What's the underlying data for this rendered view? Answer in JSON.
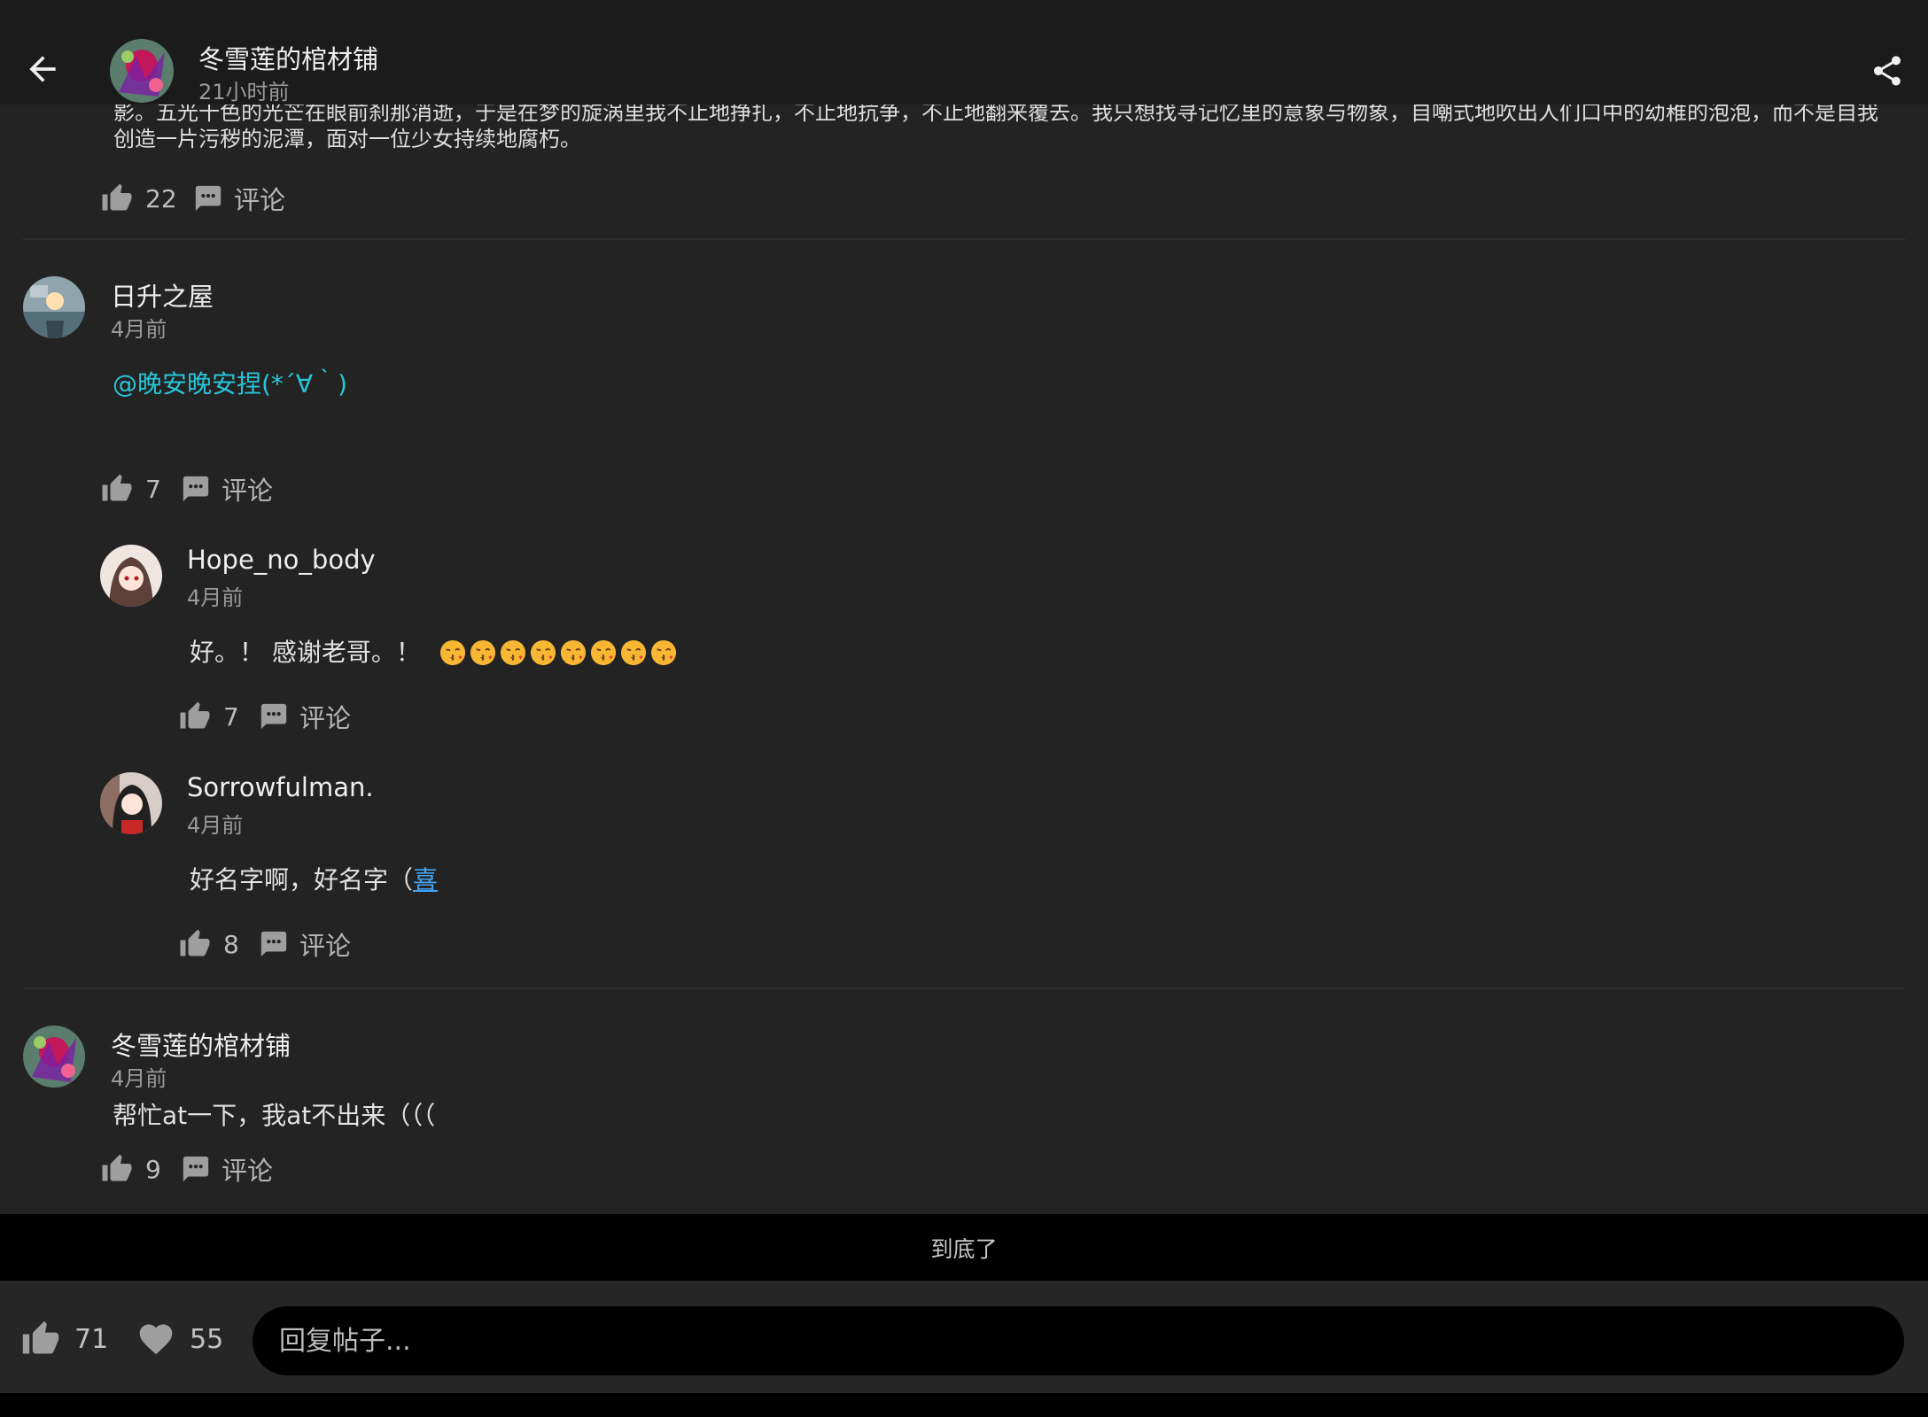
{
  "header": {
    "author": "冬雪莲的棺材铺",
    "time": "21小时前"
  },
  "post": {
    "text": "影。五光十色的光芒在眼前刹那消逝，于是在梦的旋涡里我不止地挣扎，不止地抗争，不止地翻来覆去。我只想找寻记忆里的意象与物象，自嘲式地吹出人们口中的幼稚的泡泡，而不是自我创造一片污秽的泥潭，面对一位少女持续地腐朽。",
    "likes": "22",
    "comment_label": "评论"
  },
  "comments": [
    {
      "user": "日升之屋",
      "time": "4月前",
      "text": "@晚安晚安捏(*´∀｀)",
      "likes": "7",
      "comment_label": "评论",
      "replies": [
        {
          "user": "Hope_no_body",
          "time": "4月前",
          "text": "好。！ 感谢老哥。！",
          "emoji_count": 8,
          "likes": "7",
          "comment_label": "评论"
        },
        {
          "user": "Sorrowfulman.",
          "time": "4月前",
          "text": "好名字啊，好名字（",
          "link": "喜",
          "likes": "8",
          "comment_label": "评论"
        }
      ]
    },
    {
      "user": "冬雪莲的棺材铺",
      "time": "4月前",
      "text": "帮忙at一下，我at不出来（（（",
      "likes": "9",
      "comment_label": "评论"
    }
  ],
  "end_text": "到底了",
  "bottom": {
    "likes": "71",
    "favorites": "55",
    "reply_placeholder": "回复帖子..."
  },
  "colors": {
    "background": "#232323",
    "mention": "#26c6da",
    "link": "#42a5f5"
  }
}
